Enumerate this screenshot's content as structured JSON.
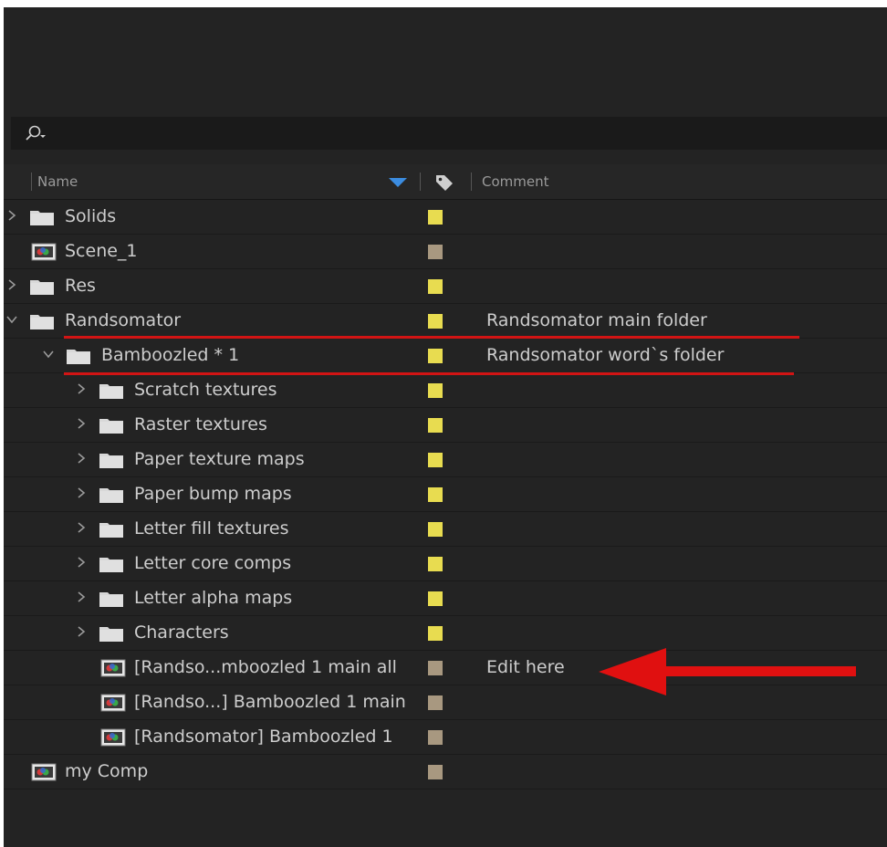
{
  "search": {
    "placeholder": ""
  },
  "header": {
    "name_label": "Name",
    "comment_label": "Comment"
  },
  "colors": {
    "label_yellow": "#e8dc50",
    "label_tan": "#a89880",
    "annotation_red": "#d11414",
    "folder_icon": "#d8d8d8"
  },
  "rows": [
    {
      "name": "Solids",
      "type": "folder",
      "depth": 0,
      "twisty": "collapsed",
      "label": "yellow",
      "comment": ""
    },
    {
      "name": "Scene_1",
      "type": "comp",
      "depth": 0,
      "twisty": "none",
      "label": "tan",
      "comment": ""
    },
    {
      "name": "Res",
      "type": "folder",
      "depth": 0,
      "twisty": "collapsed",
      "label": "yellow",
      "comment": ""
    },
    {
      "name": "Randsomator",
      "type": "folder",
      "depth": 0,
      "twisty": "expanded",
      "label": "yellow",
      "comment": "Randsomator main folder"
    },
    {
      "name": "Bamboozled * 1",
      "type": "folder",
      "depth": 1,
      "twisty": "expanded",
      "label": "yellow",
      "comment": "Randsomator word`s folder"
    },
    {
      "name": "Scratch textures",
      "type": "folder",
      "depth": 2,
      "twisty": "collapsed",
      "label": "yellow",
      "comment": ""
    },
    {
      "name": "Raster textures",
      "type": "folder",
      "depth": 2,
      "twisty": "collapsed",
      "label": "yellow",
      "comment": ""
    },
    {
      "name": "Paper texture maps",
      "type": "folder",
      "depth": 2,
      "twisty": "collapsed",
      "label": "yellow",
      "comment": ""
    },
    {
      "name": "Paper bump maps",
      "type": "folder",
      "depth": 2,
      "twisty": "collapsed",
      "label": "yellow",
      "comment": ""
    },
    {
      "name": "Letter fill textures",
      "type": "folder",
      "depth": 2,
      "twisty": "collapsed",
      "label": "yellow",
      "comment": ""
    },
    {
      "name": "Letter core comps",
      "type": "folder",
      "depth": 2,
      "twisty": "collapsed",
      "label": "yellow",
      "comment": ""
    },
    {
      "name": "Letter alpha maps",
      "type": "folder",
      "depth": 2,
      "twisty": "collapsed",
      "label": "yellow",
      "comment": ""
    },
    {
      "name": "Characters",
      "type": "folder",
      "depth": 2,
      "twisty": "collapsed",
      "label": "yellow",
      "comment": ""
    },
    {
      "name": "[Randso...mboozled 1 main all",
      "type": "comp",
      "depth": 2,
      "twisty": "none",
      "label": "tan",
      "comment": "Edit here"
    },
    {
      "name": "[Randso...] Bamboozled 1 main",
      "type": "comp",
      "depth": 2,
      "twisty": "none",
      "label": "tan",
      "comment": ""
    },
    {
      "name": "[Randsomator] Bamboozled 1",
      "type": "comp",
      "depth": 2,
      "twisty": "none",
      "label": "tan",
      "comment": ""
    },
    {
      "name": "my Comp",
      "type": "comp",
      "depth": 0,
      "twisty": "none",
      "label": "tan",
      "comment": ""
    }
  ]
}
